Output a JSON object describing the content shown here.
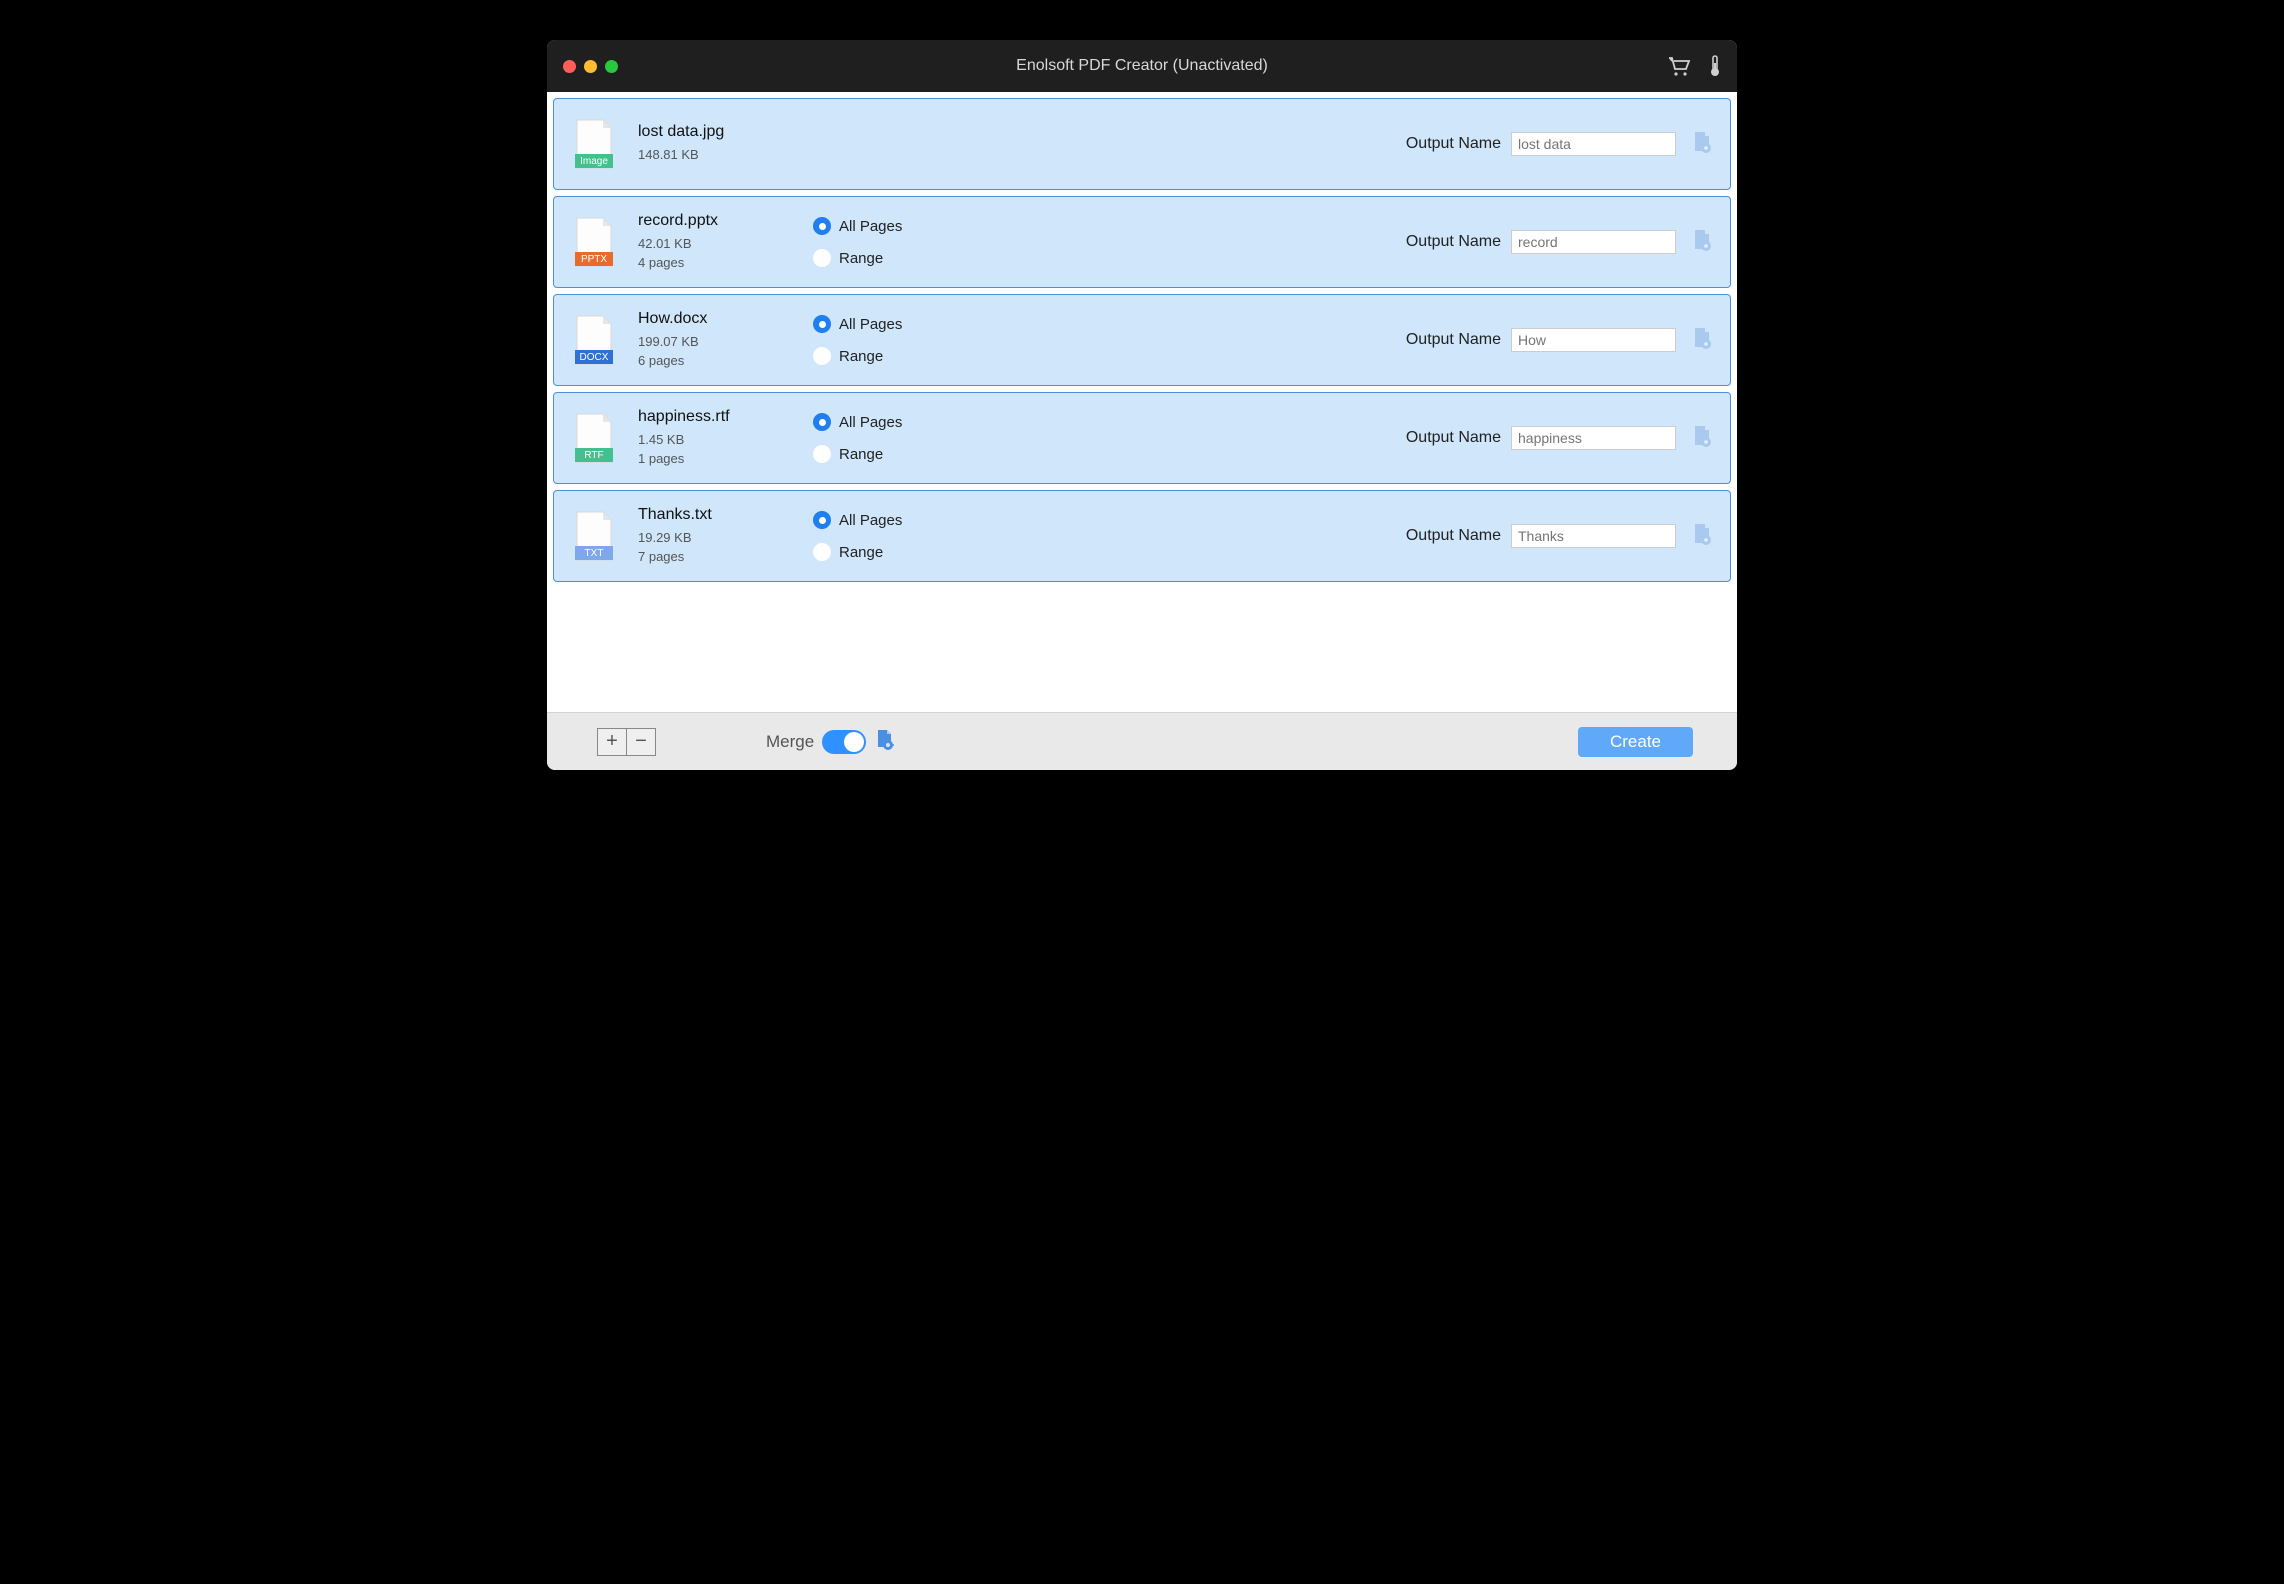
{
  "window": {
    "title": "Enolsoft PDF Creator (Unactivated)"
  },
  "labels": {
    "all_pages": "All Pages",
    "range": "Range",
    "output_name": "Output Name",
    "merge": "Merge",
    "create": "Create",
    "add": "+",
    "remove": "−"
  },
  "files": [
    {
      "name": "lost data.jpg",
      "size": "148.81 KB",
      "pages": null,
      "type": "Image",
      "type_bg": "#43c08e",
      "output": "lost data",
      "show_range": false,
      "all_selected": true
    },
    {
      "name": "record.pptx",
      "size": "42.01 KB",
      "pages": "4 pages",
      "type": "PPTX",
      "type_bg": "#e86a2c",
      "output": "record",
      "show_range": true,
      "all_selected": true
    },
    {
      "name": "How.docx",
      "size": "199.07 KB",
      "pages": "6 pages",
      "type": "DOCX",
      "type_bg": "#2f72d6",
      "output": "How",
      "show_range": true,
      "all_selected": true
    },
    {
      "name": "happiness.rtf",
      "size": "1.45 KB",
      "pages": "1 pages",
      "type": "RTF",
      "type_bg": "#43c08e",
      "output": "happiness",
      "show_range": true,
      "all_selected": true
    },
    {
      "name": "Thanks.txt",
      "size": "19.29 KB",
      "pages": "7 pages",
      "type": "TXT",
      "type_bg": "#7ea8e8",
      "output": "Thanks",
      "show_range": true,
      "all_selected": true
    }
  ],
  "merge_on": true
}
